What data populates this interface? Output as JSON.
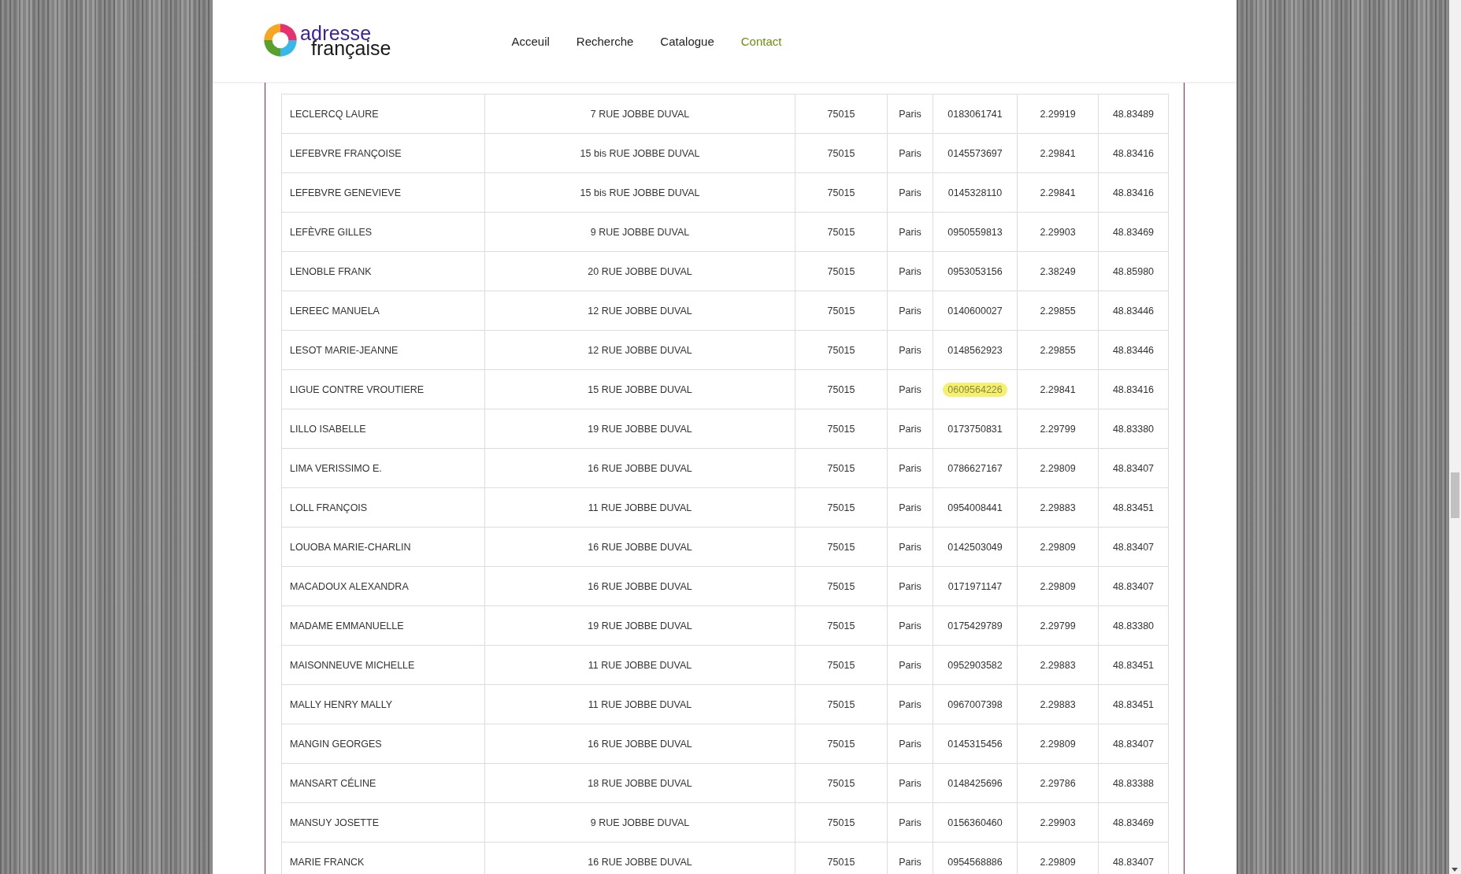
{
  "header": {
    "logo": {
      "line_1": "adresse",
      "line_2": "française"
    },
    "nav": [
      {
        "label": "Acceuil",
        "selected": false
      },
      {
        "label": "Recherche",
        "selected": false
      },
      {
        "label": "Catalogue",
        "selected": false
      },
      {
        "label": "Contact",
        "selected": true
      }
    ]
  },
  "table": {
    "rows": [
      {
        "name": "LECLERCQ LAURE",
        "address": "7 RUE JOBBE DUVAL",
        "postcode": "75015",
        "city": "Paris",
        "phone": "0183061741",
        "phone_highlighted": false,
        "longitude": "2.29919",
        "latitude": "48.83489"
      },
      {
        "name": "LEFEBVRE FRANÇOISE",
        "address": "15 bis RUE JOBBE DUVAL",
        "postcode": "75015",
        "city": "Paris",
        "phone": "0145573697",
        "phone_highlighted": false,
        "longitude": "2.29841",
        "latitude": "48.83416"
      },
      {
        "name": "LEFEBVRE GENEVIEVE",
        "address": "15 bis RUE JOBBE DUVAL",
        "postcode": "75015",
        "city": "Paris",
        "phone": "0145328110",
        "phone_highlighted": false,
        "longitude": "2.29841",
        "latitude": "48.83416"
      },
      {
        "name": "LEFÈVRE GILLES",
        "address": "9 RUE JOBBE DUVAL",
        "postcode": "75015",
        "city": "Paris",
        "phone": "0950559813",
        "phone_highlighted": false,
        "longitude": "2.29903",
        "latitude": "48.83469"
      },
      {
        "name": "LENOBLE FRANK",
        "address": "20 RUE JOBBE DUVAL",
        "postcode": "75015",
        "city": "Paris",
        "phone": "0953053156",
        "phone_highlighted": false,
        "longitude": "2.38249",
        "latitude": "48.85980"
      },
      {
        "name": "LEREEC MANUELA",
        "address": "12 RUE JOBBE DUVAL",
        "postcode": "75015",
        "city": "Paris",
        "phone": "0140600027",
        "phone_highlighted": false,
        "longitude": "2.29855",
        "latitude": "48.83446"
      },
      {
        "name": "LESOT MARIE-JEANNE",
        "address": "12 RUE JOBBE DUVAL",
        "postcode": "75015",
        "city": "Paris",
        "phone": "0148562923",
        "phone_highlighted": false,
        "longitude": "2.29855",
        "latitude": "48.83446"
      },
      {
        "name": "LIGUE CONTRE VROUTIERE",
        "address": "15 RUE JOBBE DUVAL",
        "postcode": "75015",
        "city": "Paris",
        "phone": "0609564226",
        "phone_highlighted": true,
        "longitude": "2.29841",
        "latitude": "48.83416"
      },
      {
        "name": "LILLO ISABELLE",
        "address": "19 RUE JOBBE DUVAL",
        "postcode": "75015",
        "city": "Paris",
        "phone": "0173750831",
        "phone_highlighted": false,
        "longitude": "2.29799",
        "latitude": "48.83380"
      },
      {
        "name": "LIMA VERISSIMO E.",
        "address": "16 RUE JOBBE DUVAL",
        "postcode": "75015",
        "city": "Paris",
        "phone": "0786627167",
        "phone_highlighted": false,
        "longitude": "2.29809",
        "latitude": "48.83407"
      },
      {
        "name": "LOLL FRANÇOIS",
        "address": "11 RUE JOBBE DUVAL",
        "postcode": "75015",
        "city": "Paris",
        "phone": "0954008441",
        "phone_highlighted": false,
        "longitude": "2.29883",
        "latitude": "48.83451"
      },
      {
        "name": "LOUOBA MARIE-CHARLIN",
        "address": "16 RUE JOBBE DUVAL",
        "postcode": "75015",
        "city": "Paris",
        "phone": "0142503049",
        "phone_highlighted": false,
        "longitude": "2.29809",
        "latitude": "48.83407"
      },
      {
        "name": "MACADOUX ALEXANDRA",
        "address": "16 RUE JOBBE DUVAL",
        "postcode": "75015",
        "city": "Paris",
        "phone": "0171971147",
        "phone_highlighted": false,
        "longitude": "2.29809",
        "latitude": "48.83407"
      },
      {
        "name": "MADAME EMMANUELLE",
        "address": "19 RUE JOBBE DUVAL",
        "postcode": "75015",
        "city": "Paris",
        "phone": "0175429789",
        "phone_highlighted": false,
        "longitude": "2.29799",
        "latitude": "48.83380"
      },
      {
        "name": "MAISONNEUVE MICHELLE",
        "address": "11 RUE JOBBE DUVAL",
        "postcode": "75015",
        "city": "Paris",
        "phone": "0952903582",
        "phone_highlighted": false,
        "longitude": "2.29883",
        "latitude": "48.83451"
      },
      {
        "name": "MALLY HENRY MALLY",
        "address": "11 RUE JOBBE DUVAL",
        "postcode": "75015",
        "city": "Paris",
        "phone": "0967007398",
        "phone_highlighted": false,
        "longitude": "2.29883",
        "latitude": "48.83451"
      },
      {
        "name": "MANGIN GEORGES",
        "address": "16 RUE JOBBE DUVAL",
        "postcode": "75015",
        "city": "Paris",
        "phone": "0145315456",
        "phone_highlighted": false,
        "longitude": "2.29809",
        "latitude": "48.83407"
      },
      {
        "name": "MANSART CÉLINE",
        "address": "18 RUE JOBBE DUVAL",
        "postcode": "75015",
        "city": "Paris",
        "phone": "0148425696",
        "phone_highlighted": false,
        "longitude": "2.29786",
        "latitude": "48.83388"
      },
      {
        "name": "MANSUY JOSETTE",
        "address": "9 RUE JOBBE DUVAL",
        "postcode": "75015",
        "city": "Paris",
        "phone": "0156360460",
        "phone_highlighted": false,
        "longitude": "2.29903",
        "latitude": "48.83469"
      },
      {
        "name": "MARIE FRANCK",
        "address": "16 RUE JOBBE DUVAL",
        "postcode": "75015",
        "city": "Paris",
        "phone": "0954568886",
        "phone_highlighted": false,
        "longitude": "2.29809",
        "latitude": "48.83407"
      }
    ]
  }
}
